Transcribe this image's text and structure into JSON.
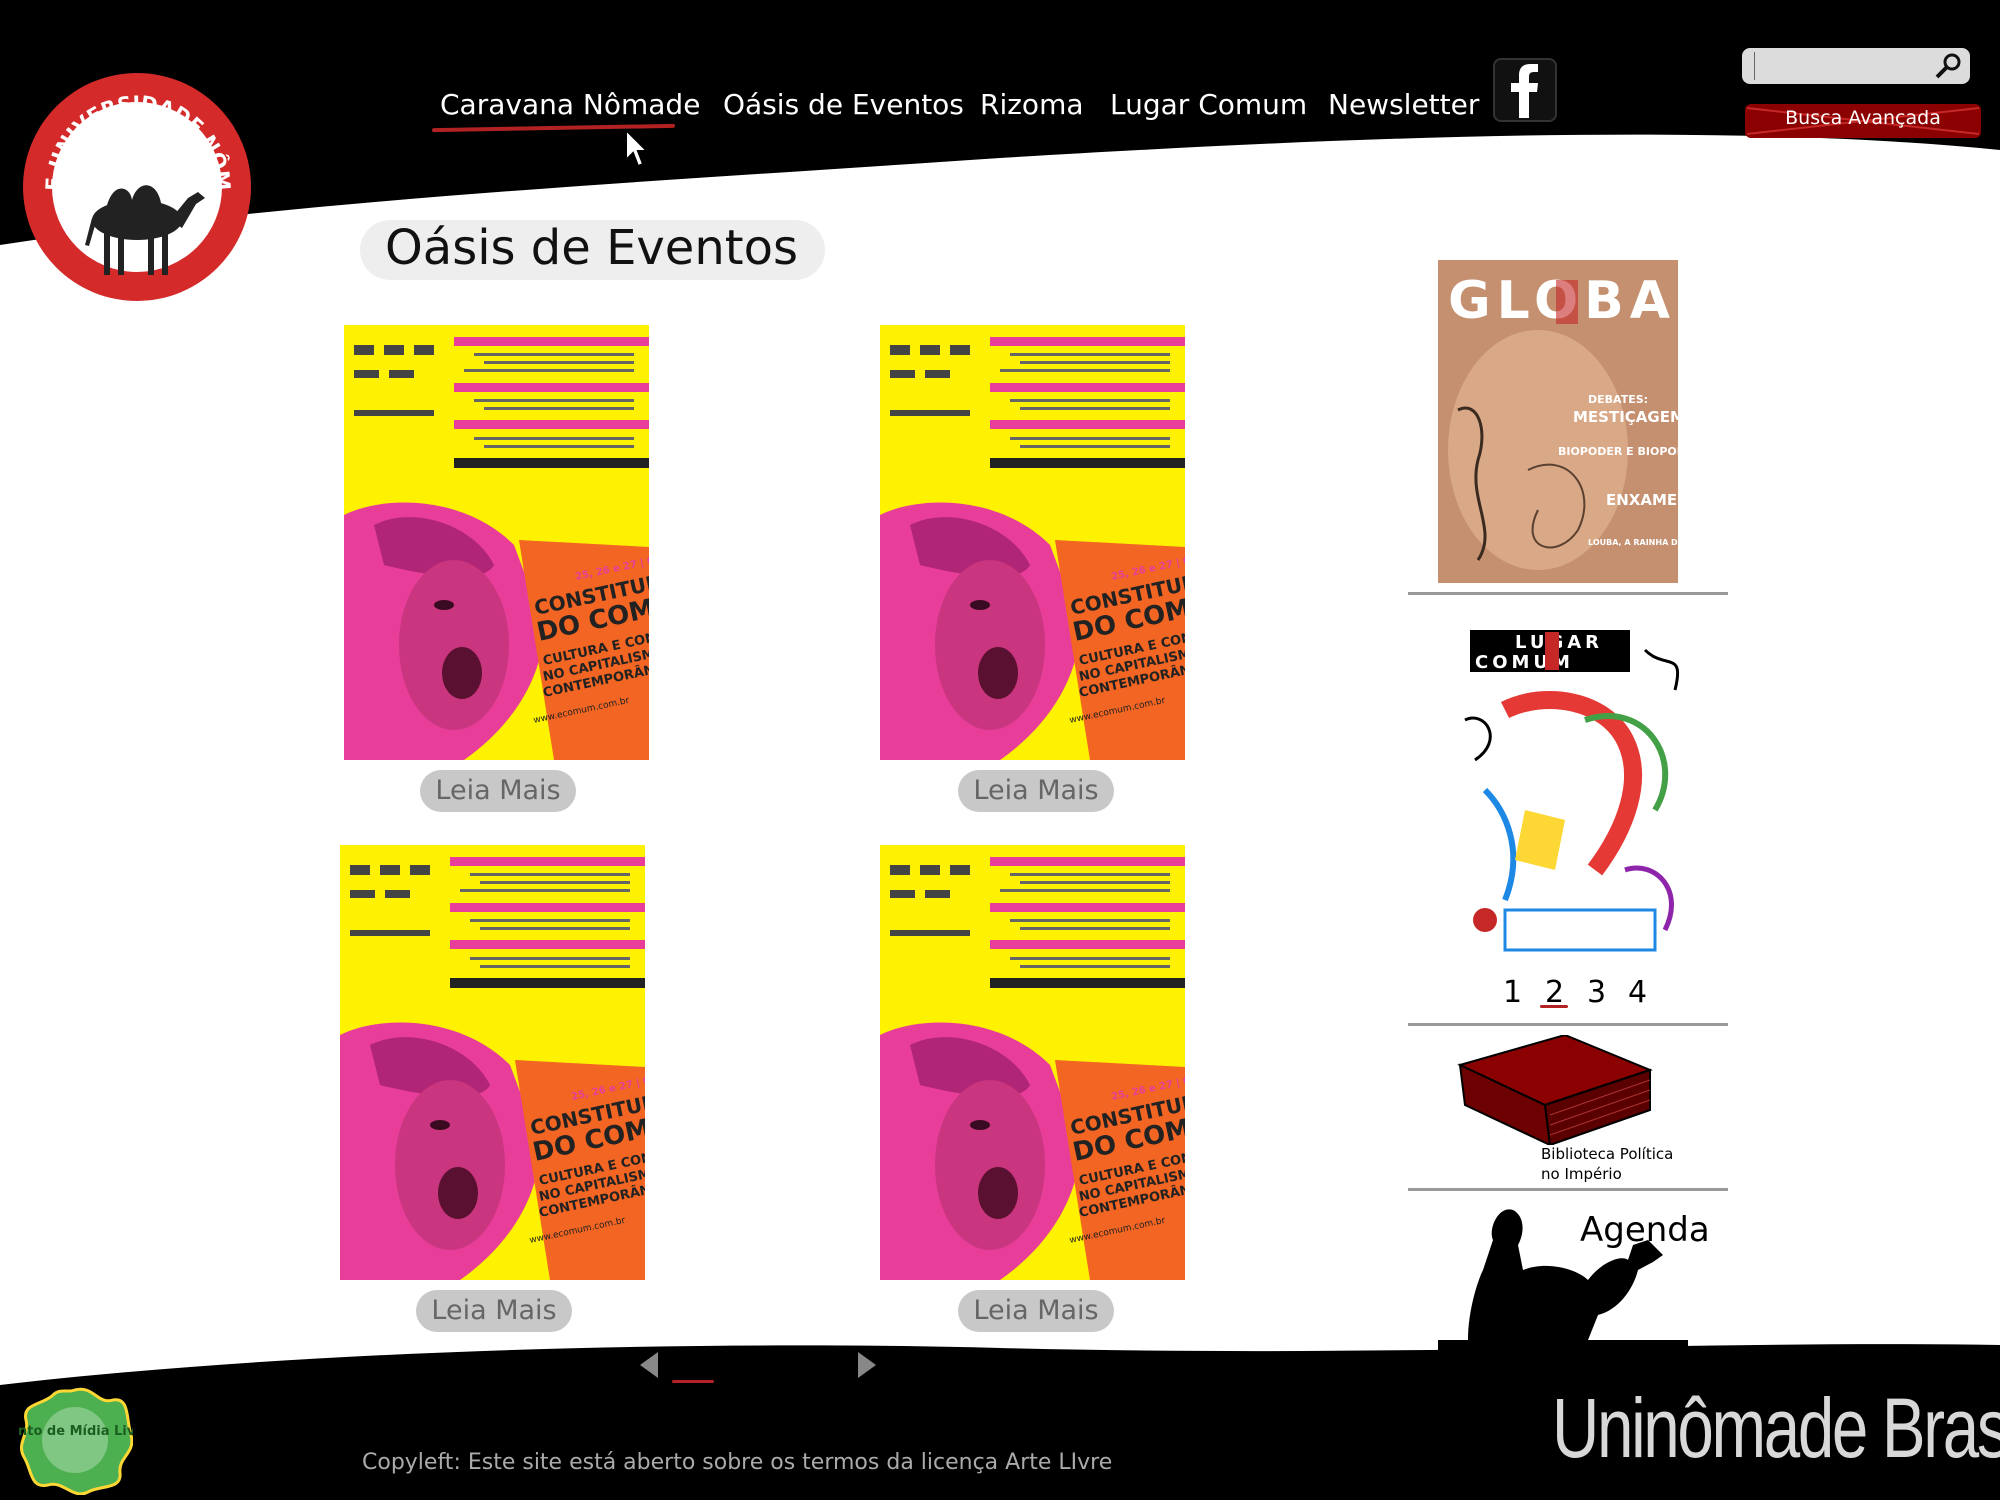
{
  "nav": {
    "items": [
      {
        "label": "Caravana Nômade"
      },
      {
        "label": "Oásis de Eventos"
      },
      {
        "label": "Rizoma"
      },
      {
        "label": "Lugar Comum"
      },
      {
        "label": "Newsletter"
      }
    ],
    "facebook_icon": "facebook-icon"
  },
  "search": {
    "placeholder": "",
    "advanced_label": "Busca Avançada"
  },
  "logo": {
    "text": "REDE UNIVERSIDADE NÔMADE"
  },
  "main": {
    "title": "Oásis de Eventos",
    "posters": [
      {
        "dates": "25, 26 e 27 | 09 | 2007",
        "headline_1": "CONSTITUIÇÃO",
        "headline_2": "DO COMUM",
        "subtitle_1": "CULTURA E CONFLITOS",
        "subtitle_2": "NO CAPITALISMO",
        "subtitle_3": "CONTEMPORÂNEO",
        "url": "www.ecomum.com.br",
        "button": "Leia Mais"
      },
      {
        "dates": "25, 26 e 27 | 09 | 2007",
        "headline_1": "CONSTITUIÇÃO",
        "headline_2": "DO COMUM",
        "subtitle_1": "CULTURA E CONFLITOS",
        "subtitle_2": "NO CAPITALISMO",
        "subtitle_3": "CONTEMPORÂNEO",
        "url": "www.ecomum.com.br",
        "button": "Leia Mais"
      },
      {
        "dates": "25, 26 e 27 | 09 | 2007",
        "headline_1": "CONSTITUIÇÃO",
        "headline_2": "DO COMUM",
        "subtitle_1": "CULTURA E CONFLITOS",
        "subtitle_2": "NO CAPITALISMO",
        "subtitle_3": "CONTEMPORÂNEO",
        "url": "www.ecomum.com.br",
        "button": "Leia Mais"
      },
      {
        "dates": "25, 26 e 27 | 09 | 2007",
        "headline_1": "CONSTITUIÇÃO",
        "headline_2": "DO COMUM",
        "subtitle_1": "CULTURA E CONFLITOS",
        "subtitle_2": "NO CAPITALISMO",
        "subtitle_3": "CONTEMPORÂNEO",
        "url": "www.ecomum.com.br",
        "button": "Leia Mais"
      }
    ],
    "pagination": [
      "1",
      "2",
      "3",
      "4"
    ],
    "current_page": "1"
  },
  "sidebar": {
    "global_cover": {
      "title": "GLOBAL",
      "topics": [
        "DEBATES:",
        "MESTIÇAGEM",
        "BIOPODER E BIOPOLÍTICA",
        "ENXAME",
        "LOUBA, A RAINHA DA LAPA"
      ]
    },
    "lugar_comum_cover": {
      "title_1": "LUGAR",
      "title_2": "COMUM"
    },
    "cover_pagination": [
      "1",
      "2",
      "3",
      "4"
    ],
    "current_cover": "2",
    "biblioteca_label_1": "Biblioteca Política",
    "biblioteca_label_2": "no Império",
    "agenda_label": "Agenda"
  },
  "footer": {
    "badge": "Ponto de Mídia Livre",
    "copyleft": "Copyleft: Este site está aberto sobre os termos da licença Arte LIvre",
    "brand_1": "Uninômade",
    "brand_2": "Brasil"
  },
  "colors": {
    "header_bg": "#000000",
    "accent_red": "#cc2229",
    "poster_yellow": "#fff200",
    "poster_magenta": "#e83e9a",
    "poster_orange": "#f26522"
  }
}
